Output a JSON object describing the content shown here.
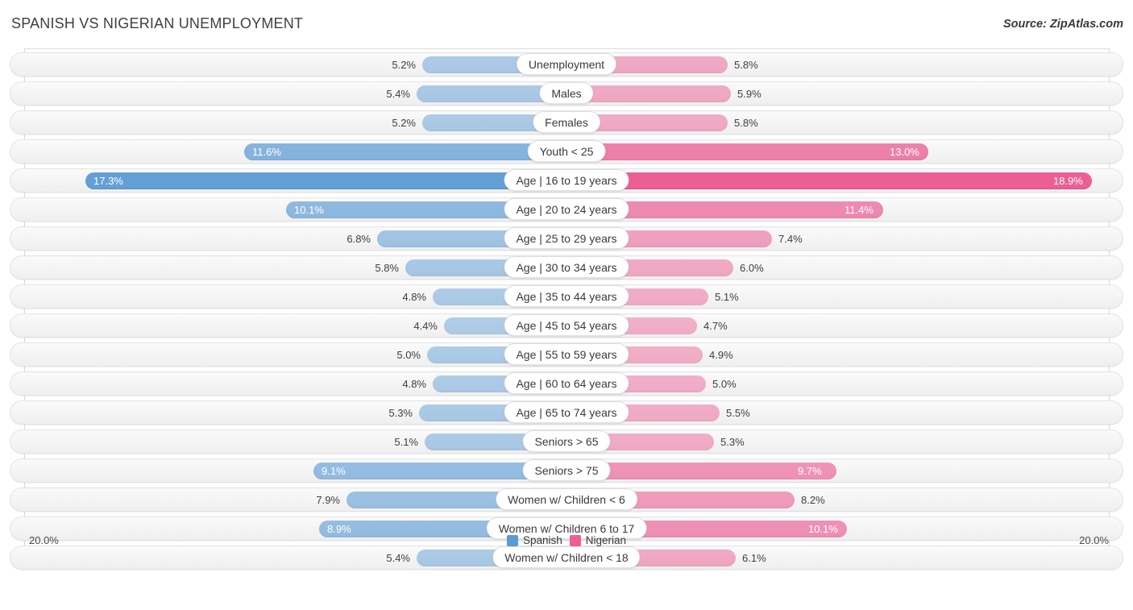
{
  "header": {
    "title": "SPANISH VS NIGERIAN UNEMPLOYMENT",
    "source": "Source: ZipAtlas.com"
  },
  "axis": {
    "left_max_label": "20.0%",
    "right_max_label": "20.0%"
  },
  "legend": {
    "items": [
      {
        "label": "Spanish",
        "color": "#5b9bd5"
      },
      {
        "label": "Nigerian",
        "color": "#ec5f95"
      }
    ]
  },
  "chart_data": {
    "type": "bar",
    "subtype": "diverging-bar",
    "title": "SPANISH VS NIGERIAN UNEMPLOYMENT",
    "xlabel": "",
    "ylabel": "",
    "xlim": [
      20.0,
      20.0
    ],
    "grid": true,
    "legend_position": "bottom-center",
    "categories": [
      "Unemployment",
      "Males",
      "Females",
      "Youth < 25",
      "Age | 16 to 19 years",
      "Age | 20 to 24 years",
      "Age | 25 to 29 years",
      "Age | 30 to 34 years",
      "Age | 35 to 44 years",
      "Age | 45 to 54 years",
      "Age | 55 to 59 years",
      "Age | 60 to 64 years",
      "Age | 65 to 74 years",
      "Seniors > 65",
      "Seniors > 75",
      "Women w/ Children < 6",
      "Women w/ Children 6 to 17",
      "Women w/ Children < 18"
    ],
    "series": [
      {
        "name": "Spanish",
        "color": "#5b9bd5",
        "side": "left",
        "values": [
          5.2,
          5.4,
          5.2,
          11.6,
          17.3,
          10.1,
          6.8,
          5.8,
          4.8,
          4.4,
          5.0,
          4.8,
          5.3,
          5.1,
          9.1,
          7.9,
          8.9,
          5.4
        ],
        "labels": [
          "5.2%",
          "5.4%",
          "5.2%",
          "11.6%",
          "17.3%",
          "10.1%",
          "6.8%",
          "5.8%",
          "4.8%",
          "4.4%",
          "5.0%",
          "4.8%",
          "5.3%",
          "5.1%",
          "9.1%",
          "7.9%",
          "8.9%",
          "5.4%"
        ]
      },
      {
        "name": "Nigerian",
        "color": "#ec5f95",
        "side": "right",
        "values": [
          5.8,
          5.9,
          5.8,
          13.0,
          18.9,
          11.4,
          7.4,
          6.0,
          5.1,
          4.7,
          4.9,
          5.0,
          5.5,
          5.3,
          9.7,
          8.2,
          10.1,
          6.1
        ],
        "labels": [
          "5.8%",
          "5.9%",
          "5.8%",
          "13.0%",
          "18.9%",
          "11.4%",
          "7.4%",
          "6.0%",
          "5.1%",
          "4.7%",
          "4.9%",
          "5.0%",
          "5.5%",
          "5.3%",
          "9.7%",
          "8.2%",
          "10.1%",
          "6.1%"
        ]
      }
    ]
  }
}
